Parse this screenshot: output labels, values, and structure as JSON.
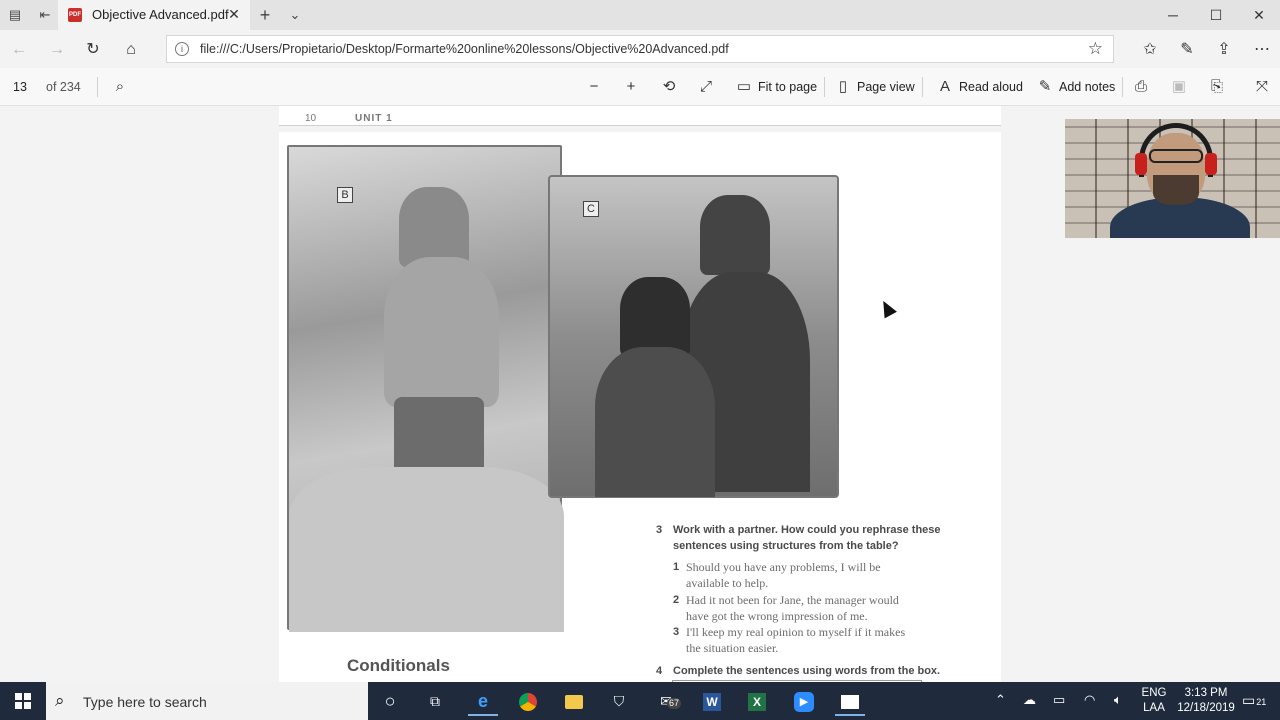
{
  "tab": {
    "title": "Objective Advanced.pdf"
  },
  "window": {
    "minimize": "─",
    "maximize": "☐",
    "close": "✕"
  },
  "address": {
    "url": "file:///C:/Users/Propietario/Desktop/Formarte%20online%20lessons/Objective%20Advanced.pdf"
  },
  "pdf_toolbar": {
    "page_current": "13",
    "page_total": "of 234",
    "fit_to_page": "Fit to page",
    "page_view": "Page view",
    "read_aloud": "Read aloud",
    "add_notes": "Add notes"
  },
  "document": {
    "prev_page_number": "10",
    "prev_page_running_head": "UNIT 1",
    "photo_b_tag": "B",
    "photo_c_tag": "C",
    "exercise3": {
      "number": "3",
      "heading_line1": "Work with a partner. How could you rephrase these",
      "heading_line2": "sentences using structures from the table?",
      "items": [
        {
          "num": "1",
          "line1": "Should you have any problems, I will be",
          "line2": "available to help."
        },
        {
          "num": "2",
          "line1": "Had it not been for Jane, the manager would",
          "line2": "have got the wrong impression of me."
        },
        {
          "num": "3",
          "line1": "I'll keep my real opinion to myself if it makes",
          "line2": "the situation easier."
        }
      ]
    },
    "exercise4": {
      "number": "4",
      "heading": "Complete the sentences using words from the box."
    },
    "section_title": "Conditionals"
  },
  "taskbar": {
    "search_placeholder": "Type here to search",
    "mail_badge": "67",
    "lang_line1": "ENG",
    "lang_line2": "LAA",
    "time": "3:13 PM",
    "date": "12/18/2019",
    "notification_count": "21"
  }
}
